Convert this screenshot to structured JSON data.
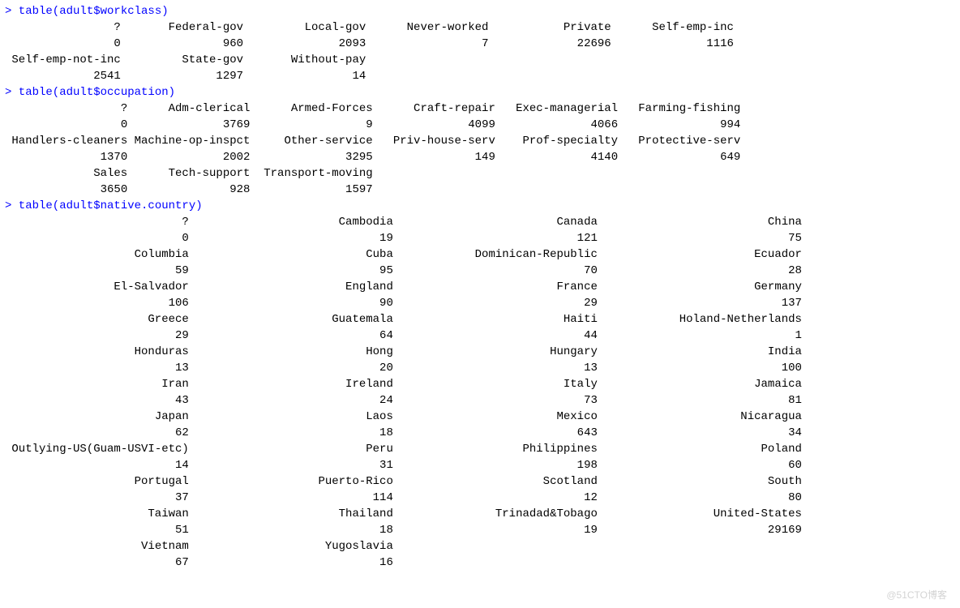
{
  "prompts": {
    "workclass": "> table(adult$workclass)",
    "occupation": "> table(adult$occupation)",
    "country": "> table(adult$native.country)"
  },
  "workclass": {
    "col_widths_ch": [
      17,
      18,
      18,
      18,
      18,
      18
    ],
    "rows": [
      [
        "?",
        "Federal-gov",
        "Local-gov",
        "Never-worked",
        "Private",
        "Self-emp-inc"
      ],
      [
        "0",
        "960",
        "2093",
        "7",
        "22696",
        "1116"
      ],
      [
        "Self-emp-not-inc",
        "State-gov",
        "Without-pay",
        "",
        "",
        ""
      ],
      [
        "2541",
        "1297",
        "14",
        "",
        "",
        ""
      ]
    ]
  },
  "occupation": {
    "col_widths_ch": [
      18,
      18,
      18,
      18,
      18,
      18
    ],
    "rows": [
      [
        "?",
        "Adm-clerical",
        "Armed-Forces",
        "Craft-repair",
        "Exec-managerial",
        "Farming-fishing"
      ],
      [
        "0",
        "3769",
        "9",
        "4099",
        "4066",
        "994"
      ],
      [
        "Handlers-cleaners",
        "Machine-op-inspct",
        "Other-service",
        "Priv-house-serv",
        "Prof-specialty",
        "Protective-serv"
      ],
      [
        "1370",
        "2002",
        "3295",
        "149",
        "4140",
        "649"
      ],
      [
        "Sales",
        "Tech-support",
        "Transport-moving",
        "",
        "",
        ""
      ],
      [
        "3650",
        "928",
        "1597",
        "",
        "",
        ""
      ]
    ]
  },
  "country": {
    "col_widths_ch": [
      27,
      30,
      30,
      30
    ],
    "rows": [
      [
        "?",
        "Cambodia",
        "Canada",
        "China"
      ],
      [
        "0",
        "19",
        "121",
        "75"
      ],
      [
        "Columbia",
        "Cuba",
        "Dominican-Republic",
        "Ecuador"
      ],
      [
        "59",
        "95",
        "70",
        "28"
      ],
      [
        "El-Salvador",
        "England",
        "France",
        "Germany"
      ],
      [
        "106",
        "90",
        "29",
        "137"
      ],
      [
        "Greece",
        "Guatemala",
        "Haiti",
        "Holand-Netherlands"
      ],
      [
        "29",
        "64",
        "44",
        "1"
      ],
      [
        "Honduras",
        "Hong",
        "Hungary",
        "India"
      ],
      [
        "13",
        "20",
        "13",
        "100"
      ],
      [
        "Iran",
        "Ireland",
        "Italy",
        "Jamaica"
      ],
      [
        "43",
        "24",
        "73",
        "81"
      ],
      [
        "Japan",
        "Laos",
        "Mexico",
        "Nicaragua"
      ],
      [
        "62",
        "18",
        "643",
        "34"
      ],
      [
        "Outlying-US(Guam-USVI-etc)",
        "Peru",
        "Philippines",
        "Poland"
      ],
      [
        "14",
        "31",
        "198",
        "60"
      ],
      [
        "Portugal",
        "Puerto-Rico",
        "Scotland",
        "South"
      ],
      [
        "37",
        "114",
        "12",
        "80"
      ],
      [
        "Taiwan",
        "Thailand",
        "Trinadad&Tobago",
        "United-States"
      ],
      [
        "51",
        "18",
        "19",
        "29169"
      ],
      [
        "Vietnam",
        "Yugoslavia",
        "",
        ""
      ],
      [
        "67",
        "16",
        "",
        ""
      ]
    ]
  },
  "watermark": "@51CTO博客"
}
